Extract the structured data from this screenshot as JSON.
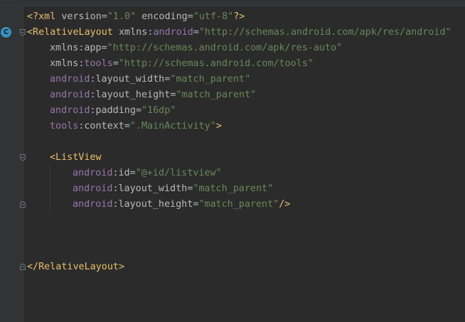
{
  "editor": {
    "gutter_badge": "C",
    "colors": {
      "background": "#2b2b2b",
      "gutter": "#313335",
      "tag": "#e8bf6a",
      "namespace": "#9876aa",
      "string": "#6a8759",
      "text": "#a9b7c6"
    },
    "code": {
      "l1": {
        "open": "<?xml",
        "a1": " version",
        "eq1": "=",
        "v1": "\"1.0\"",
        "a2": " encoding",
        "eq2": "=",
        "v2": "\"utf-8\"",
        "close": "?>"
      },
      "l2": {
        "tag": "<RelativeLayout",
        "sp": " ",
        "ns": "xmlns",
        "colon": ":",
        "attr": "android",
        "eq": "=",
        "val": "\"http://schemas.android.com/apk/res/android\""
      },
      "l3": {
        "ns": "xmlns",
        "colon": ":",
        "attr": "app",
        "eq": "=",
        "val": "\"http://schemas.android.com/apk/res-auto\""
      },
      "l4": {
        "ns": "xmlns",
        "colon": ":",
        "attr": "tools",
        "eq": "=",
        "val": "\"http://schemas.android.com/tools\""
      },
      "l5": {
        "ns": "android",
        "colon": ":",
        "attr": "layout_width",
        "eq": "=",
        "val": "\"match_parent\""
      },
      "l6": {
        "ns": "android",
        "colon": ":",
        "attr": "layout_height",
        "eq": "=",
        "val": "\"match_parent\""
      },
      "l7": {
        "ns": "android",
        "colon": ":",
        "attr": "padding",
        "eq": "=",
        "val": "\"16dp\""
      },
      "l8": {
        "ns": "tools",
        "colon": ":",
        "attr": "context",
        "eq": "=",
        "val": "\".MainActivity\"",
        "close": ">"
      },
      "l10": {
        "tag": "<ListView"
      },
      "l11": {
        "ns": "android",
        "colon": ":",
        "attr": "id",
        "eq": "=",
        "val": "\"@+id/listview\""
      },
      "l12": {
        "ns": "android",
        "colon": ":",
        "attr": "layout_width",
        "eq": "=",
        "val": "\"match_parent\""
      },
      "l13": {
        "ns": "android",
        "colon": ":",
        "attr": "layout_height",
        "eq": "=",
        "val": "\"match_parent\"",
        "close": "/>"
      },
      "l17": {
        "tag": "</RelativeLayout>"
      }
    }
  }
}
